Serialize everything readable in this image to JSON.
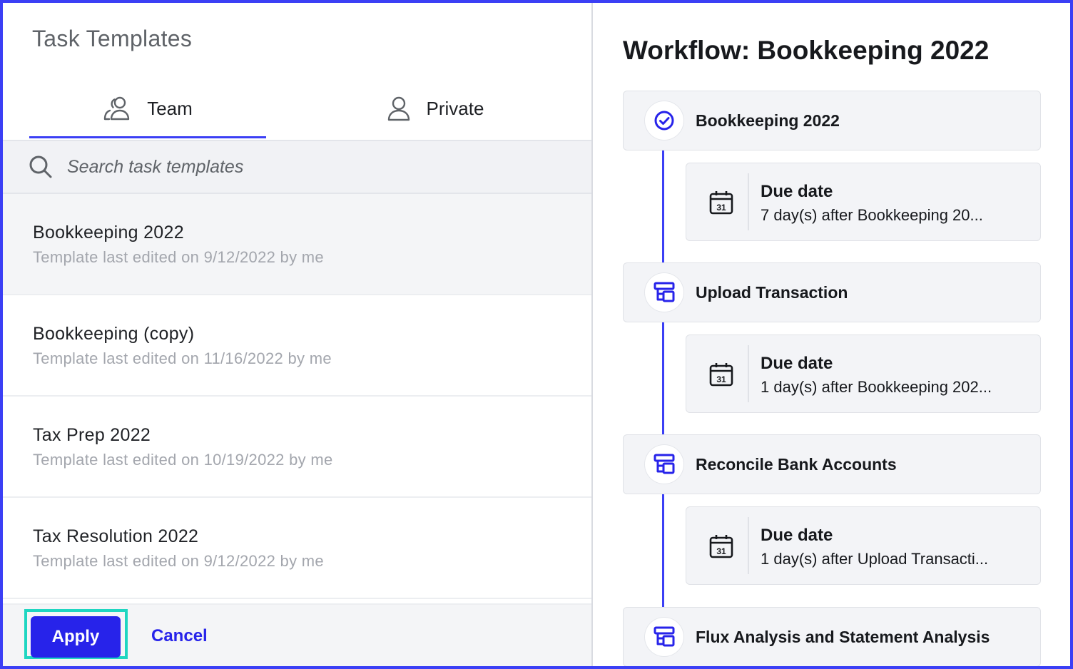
{
  "left_panel": {
    "title": "Task Templates",
    "tabs": [
      {
        "label": "Team",
        "icon": "team-icon",
        "active": true
      },
      {
        "label": "Private",
        "icon": "user-icon",
        "active": false
      }
    ],
    "search": {
      "placeholder": "Search task templates",
      "value": ""
    },
    "templates": [
      {
        "name": "Bookkeeping 2022",
        "meta": "Template last edited on 9/12/2022 by me",
        "selected": true
      },
      {
        "name": "Bookkeeping (copy)",
        "meta": "Template last edited on 11/16/2022 by me",
        "selected": false
      },
      {
        "name": "Tax Prep 2022",
        "meta": "Template last edited on 10/19/2022 by me",
        "selected": false
      },
      {
        "name": "Tax Resolution 2022",
        "meta": "Template last edited on 9/12/2022 by me",
        "selected": false
      }
    ],
    "footer": {
      "apply_label": "Apply",
      "cancel_label": "Cancel"
    }
  },
  "right_panel": {
    "title": "Workflow: Bookkeeping 2022",
    "tasks": [
      {
        "name": "Bookkeeping 2022",
        "icon": "check-circle-icon",
        "due": {
          "label": "Due date",
          "text": "7 day(s) after Bookkeeping 20..."
        }
      },
      {
        "name": "Upload Transaction",
        "icon": "task-flow-icon",
        "due": {
          "label": "Due date",
          "text": "1 day(s) after Bookkeeping 202..."
        }
      },
      {
        "name": "Reconcile Bank Accounts",
        "icon": "task-flow-icon",
        "due": {
          "label": "Due date",
          "text": "1 day(s) after Upload Transacti..."
        }
      },
      {
        "name": "Flux Analysis and Statement Analysis",
        "icon": "task-flow-icon"
      }
    ],
    "calendar_icon_day": "31"
  },
  "colors": {
    "accent": "#2723ea",
    "highlight": "#1fd6c1",
    "timeline": "#3b3ff5"
  }
}
